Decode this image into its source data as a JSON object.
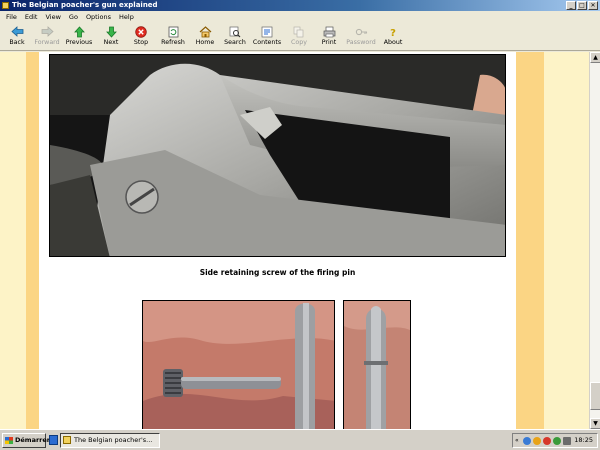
{
  "window": {
    "title": "The Belgian poacher's gun explained",
    "controls": [
      "_",
      "□",
      "✕"
    ]
  },
  "menu": [
    "File",
    "Edit",
    "View",
    "Go",
    "Options",
    "Help"
  ],
  "toolbar": [
    {
      "label": "Back",
      "icon": "back-arrow-icon",
      "enabled": true
    },
    {
      "label": "Forward",
      "icon": "forward-arrow-icon",
      "enabled": false
    },
    {
      "label": "Previous",
      "icon": "up-arrow-icon",
      "enabled": true
    },
    {
      "label": "Next",
      "icon": "down-arrow-icon",
      "enabled": true
    },
    {
      "label": "Stop",
      "icon": "stop-icon",
      "enabled": true
    },
    {
      "label": "Refresh",
      "icon": "refresh-icon",
      "enabled": true
    },
    {
      "label": "Home",
      "icon": "home-icon",
      "enabled": true
    },
    {
      "label": "Search",
      "icon": "search-icon",
      "enabled": true
    },
    {
      "label": "Contents",
      "icon": "contents-icon",
      "enabled": true
    },
    {
      "label": "Copy",
      "icon": "copy-icon",
      "enabled": false
    },
    {
      "label": "Print",
      "icon": "print-icon",
      "enabled": true
    },
    {
      "label": "Password",
      "icon": "key-icon",
      "enabled": false
    },
    {
      "label": "About",
      "icon": "help-icon",
      "enabled": true
    }
  ],
  "content": {
    "caption": "Side retaining screw of the firing pin",
    "colors": {
      "background": "#fdf3c7",
      "band": "#fbd584",
      "page": "#ffffff"
    }
  },
  "taskbar": {
    "start_label": "Démarrer",
    "task_label": "The Belgian poacher's...",
    "clock": "18:25"
  }
}
